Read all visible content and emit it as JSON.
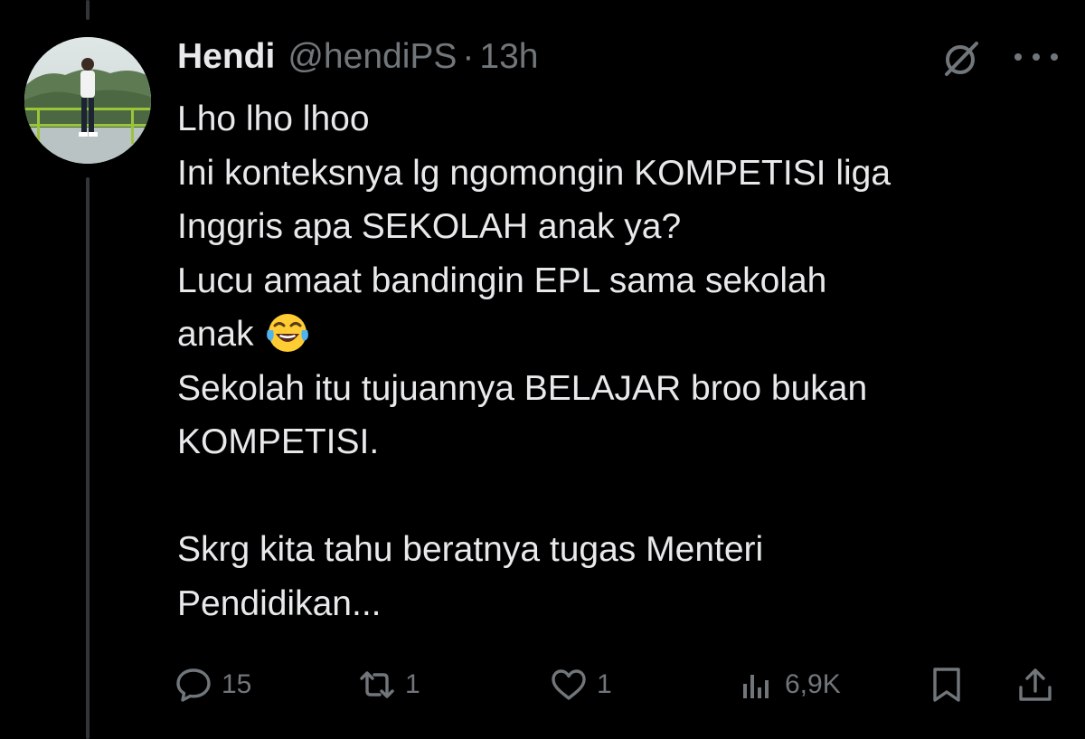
{
  "tweet": {
    "author": {
      "display_name": "Hendi",
      "handle": "@hendiPS",
      "separator": "·",
      "time": "13h"
    },
    "text_lines": [
      "Lho lho lhoo",
      "Ini konteksnya lg ngomongin KOMPETISI liga",
      "Inggris apa SEKOLAH anak ya?",
      "Lucu amaat bandingin EPL sama sekolah",
      "anak",
      "Sekolah itu tujuannya BELAJAR broo bukan",
      "KOMPETISI.",
      "",
      "Skrg kita tahu beratnya tugas Menteri",
      "Pendidikan..."
    ],
    "emoji": "face-with-tears-of-joy",
    "actions": {
      "replies": "15",
      "reposts": "1",
      "likes": "1",
      "views": "6,9K"
    }
  },
  "colors": {
    "background": "#000000",
    "text_primary": "#e7e9ea",
    "text_secondary": "#71767b",
    "thread_line": "#333639"
  },
  "icons": [
    "grok-icon",
    "more-icon",
    "reply-icon",
    "repost-icon",
    "like-icon",
    "views-icon",
    "bookmark-icon",
    "share-icon"
  ]
}
